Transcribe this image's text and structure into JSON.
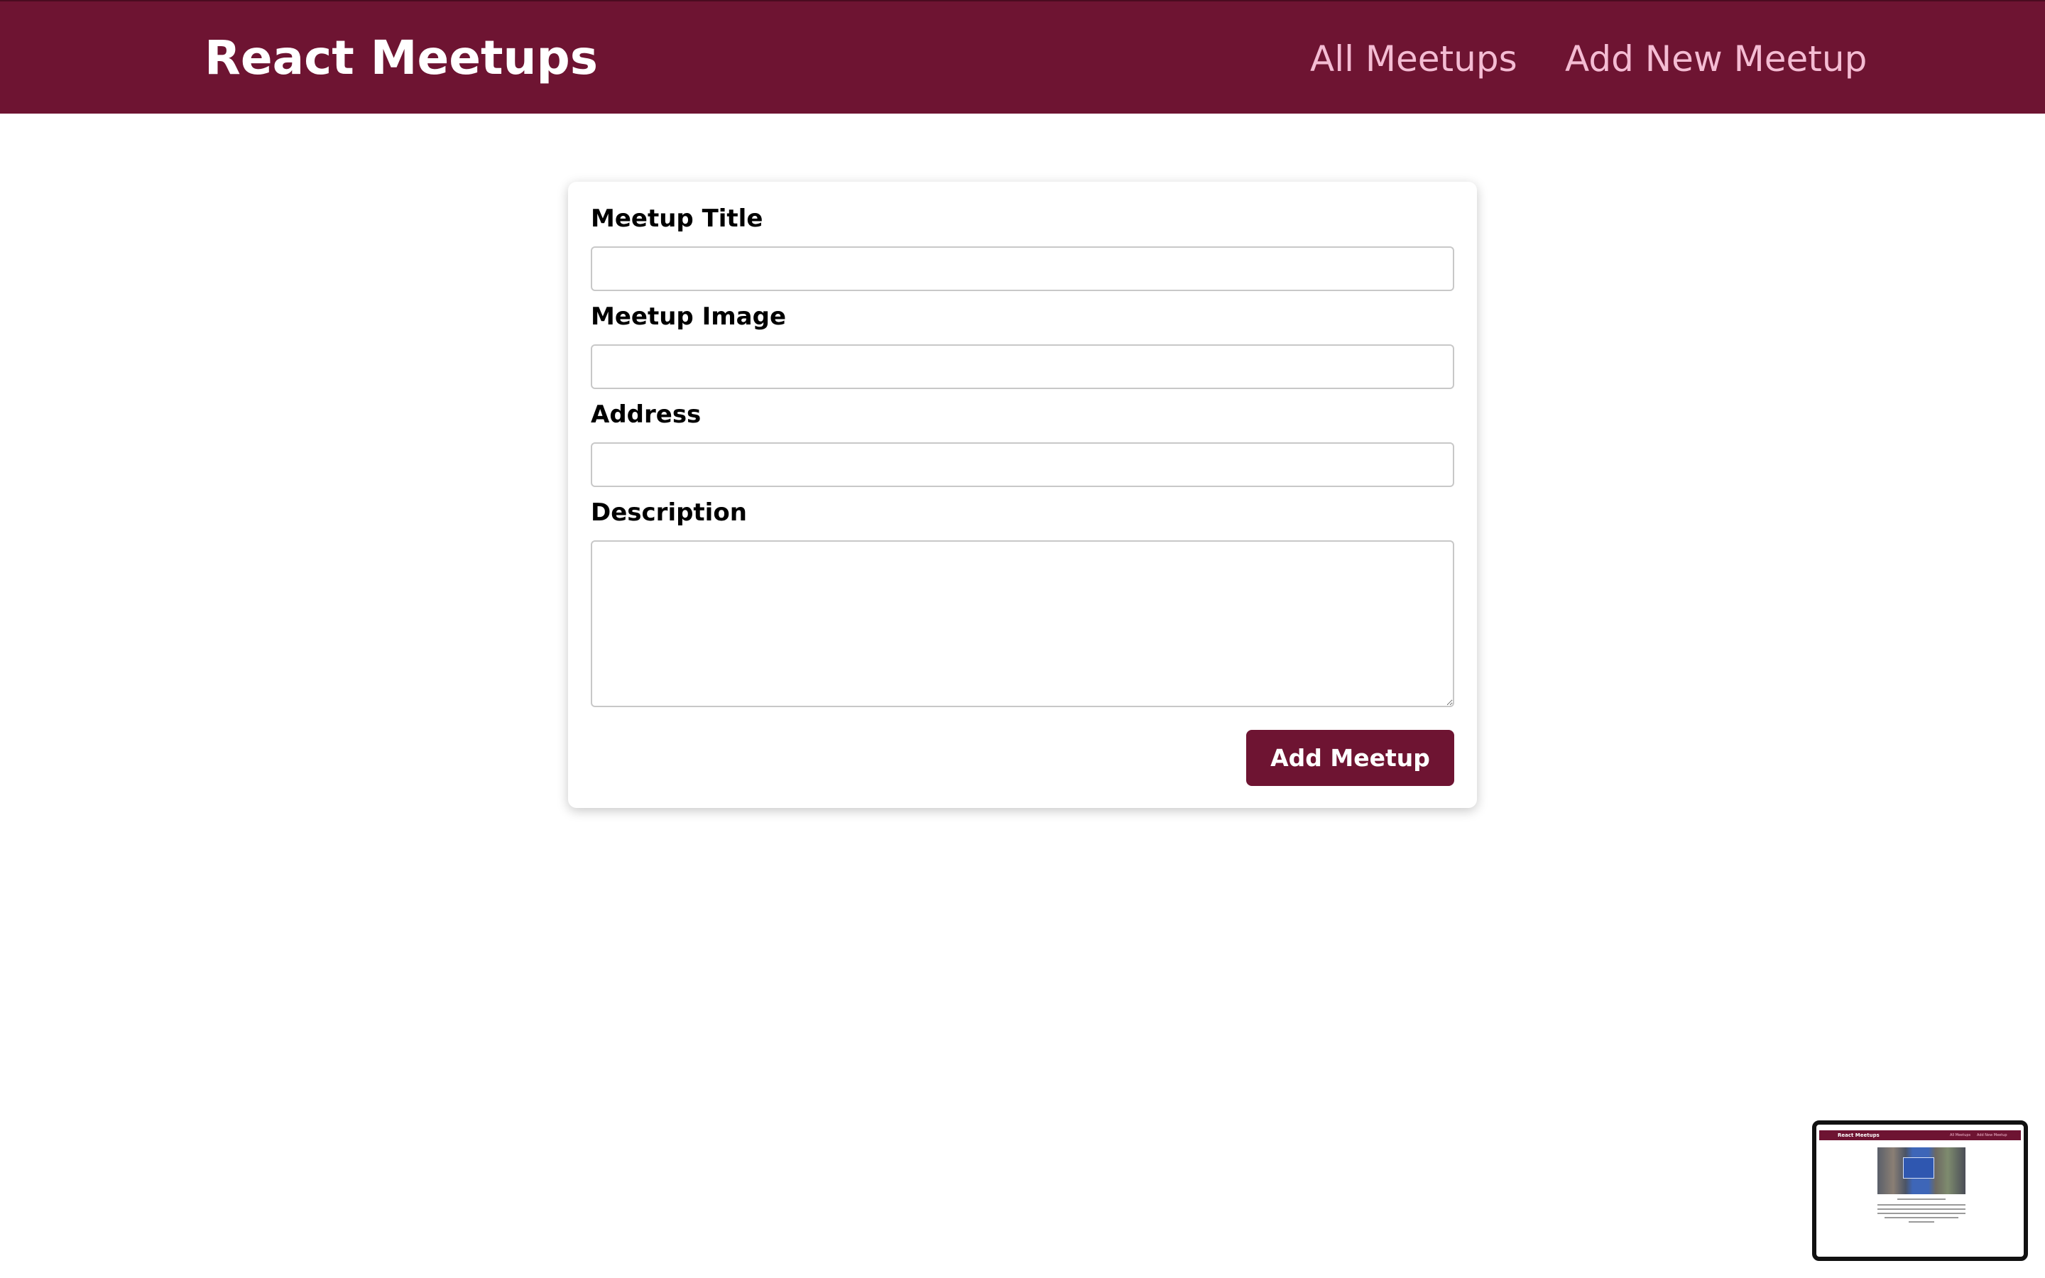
{
  "header": {
    "brand": "React Meetups",
    "nav": [
      {
        "label": "All Meetups"
      },
      {
        "label": "Add New Meetup"
      }
    ]
  },
  "form": {
    "fields": [
      {
        "label": "Meetup Title",
        "value": ""
      },
      {
        "label": "Meetup Image",
        "value": ""
      },
      {
        "label": "Address",
        "value": ""
      },
      {
        "label": "Description",
        "value": ""
      }
    ],
    "submit_label": "Add Meetup"
  },
  "colors": {
    "brand": "#6e1432",
    "nav_text": "#f4bcd3",
    "field_border": "#c8c8c8"
  },
  "preview_thumbnail": {
    "brand": "React Meetups",
    "nav": [
      "All Meetups",
      "Add New Meetup"
    ]
  }
}
